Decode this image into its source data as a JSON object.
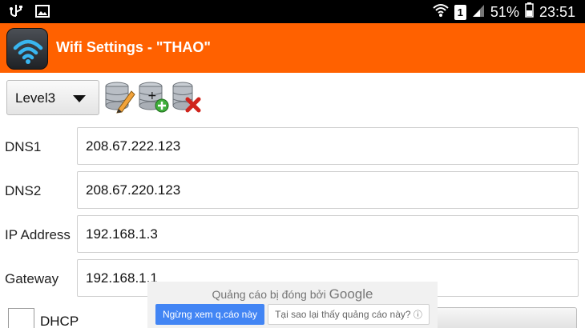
{
  "status_bar": {
    "battery": "51%",
    "time": "23:51",
    "sim": "1",
    "icons": [
      "usb-icon",
      "image-icon",
      "wifi-icon",
      "sim-icon",
      "signal-icon",
      "battery-icon"
    ]
  },
  "title_bar": {
    "title": "Wifi Settings - \"THAO\"",
    "app_icon": "wifi-icon"
  },
  "toolbar": {
    "profile_select": "Level3",
    "edit_icon": "database-edit-icon",
    "add_icon": "database-add-icon",
    "delete_icon": "database-delete-icon"
  },
  "form": {
    "rows": [
      {
        "label": "DNS1",
        "value": "208.67.222.123"
      },
      {
        "label": "DNS2",
        "value": "208.67.220.123"
      },
      {
        "label": "IP Address",
        "value": "192.168.1.3"
      },
      {
        "label": "Gateway",
        "value": "192.168.1.1"
      }
    ],
    "dhcp_label": "DHCP"
  },
  "ad": {
    "closed_text": "Quảng cáo bị đóng bởi",
    "brand": "Google",
    "stop_button": "Ngừng xem q.cáo này",
    "why_button": "Tại sao lại thấy quảng cáo này?",
    "info_icon": "info-icon"
  },
  "colors": {
    "title_bar": "#ff6100",
    "status_bar": "#000000",
    "ad_primary": "#4285f4"
  }
}
